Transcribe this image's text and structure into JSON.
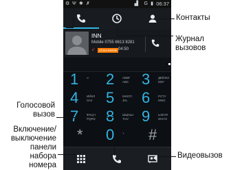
{
  "status_bar": {
    "time": "06:37",
    "icons_left": [
      "tty-icon",
      "usb-icon",
      "debug-icon",
      "missed-call-icon"
    ],
    "icons_right": [
      "signal-icon",
      "g-network-icon",
      "battery-icon"
    ],
    "carrier": "G"
  },
  "tabs": [
    {
      "name": "dialer",
      "icon": "phone-icon",
      "active": true
    },
    {
      "name": "call-log",
      "icon": "clock-icon",
      "active": false
    },
    {
      "name": "contacts",
      "icon": "person-icon",
      "active": false
    }
  ],
  "recent_call": {
    "name": "INN",
    "number": "Mobile 0755 8613 8281",
    "badge": "China Mobile",
    "time": "04:50"
  },
  "dialpad": [
    {
      "digit": "1",
      "letters": [
        "∞"
      ]
    },
    {
      "digit": "2",
      "letters": [
        "АБВГ",
        "ABC"
      ]
    },
    {
      "digit": "3",
      "letters": [
        "ДЕЁЖЗ",
        "DEF"
      ]
    },
    {
      "digit": "4",
      "letters": [
        "ИЙКЛ",
        "GHI"
      ]
    },
    {
      "digit": "5",
      "letters": [
        "МНОП",
        "JKL"
      ]
    },
    {
      "digit": "6",
      "letters": [
        "РСТУ",
        "MNO"
      ]
    },
    {
      "digit": "7",
      "letters": [
        "ФХЦЧ",
        "PQRS"
      ]
    },
    {
      "digit": "8",
      "letters": [
        "ШЩЪЫ",
        "TUV"
      ]
    },
    {
      "digit": "9",
      "letters": [
        "ЬЭЮЯ",
        "WXYZ"
      ]
    },
    {
      "digit": "*",
      "letters": []
    },
    {
      "digit": "0",
      "letters": [
        "+"
      ]
    },
    {
      "digit": "#",
      "letters": []
    }
  ],
  "bottom_bar": [
    {
      "name": "dialpad-toggle",
      "icon": "dialpad-icon"
    },
    {
      "name": "voice-call",
      "icon": "phone-icon"
    },
    {
      "name": "video-call",
      "icon": "video-call-icon"
    }
  ],
  "callouts": {
    "contacts": "Контакты",
    "call_log": [
      "Журнал",
      "вызовов"
    ],
    "voice_call": [
      "Голосовой",
      "вызов"
    ],
    "dialpad_toggle": [
      "Включение/",
      "выключение",
      "панели",
      "набора",
      "номера"
    ],
    "video_call": "Видеовызов"
  },
  "colors": {
    "accent": "#33b5e5",
    "missed": "#e53935",
    "badge": "#ff7a00",
    "background": "#0c0f13"
  }
}
